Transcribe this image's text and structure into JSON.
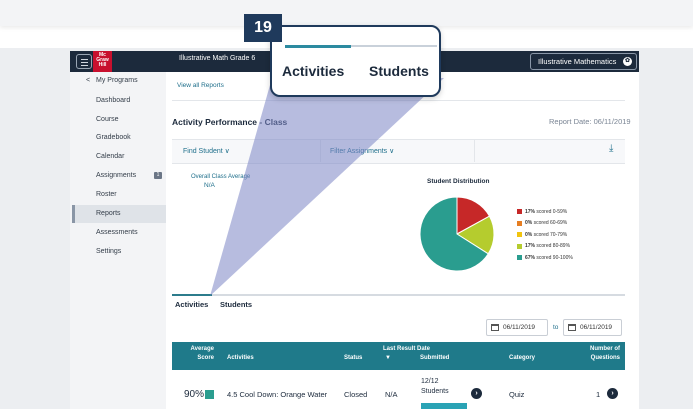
{
  "header": {
    "logo_text": "Mc Graw Hill",
    "app_title": "Illustrative Math Grade 6",
    "brand": "Illustrative Mathematics"
  },
  "sidebar": {
    "back_label": "My Programs",
    "items": [
      {
        "label": "Dashboard"
      },
      {
        "label": "Course"
      },
      {
        "label": "Gradebook"
      },
      {
        "label": "Calendar"
      },
      {
        "label": "Assignments",
        "badge": "1"
      },
      {
        "label": "Roster"
      },
      {
        "label": "Reports",
        "active": true
      },
      {
        "label": "Assessments"
      },
      {
        "label": "Settings"
      }
    ]
  },
  "main": {
    "view_all": "View all Reports",
    "title": "Activity Performance - Class",
    "report_date": "Report Date: 06/11/2019",
    "find_student": "Find Student",
    "filter_assignments": "Filter Assignments",
    "overall_label": "Overall Class Average",
    "overall_value": "N/A",
    "distribution_title": "Student Distribution",
    "tabs": [
      "Activities",
      "Students"
    ],
    "date_from": "06/11/2019",
    "date_to_label": "to",
    "date_to": "06/11/2019"
  },
  "chart_data": {
    "type": "pie",
    "title": "Student Distribution",
    "slices": [
      {
        "label": "scored 0-59%",
        "pct_text": "17%",
        "value": 17,
        "color": "#c62828"
      },
      {
        "label": "scored 60-69%",
        "pct_text": "0%",
        "value": 0,
        "color": "#e67e22"
      },
      {
        "label": "scored 70-79%",
        "pct_text": "0%",
        "value": 0,
        "color": "#f1c40f"
      },
      {
        "label": "scored 80-89%",
        "pct_text": "17%",
        "value": 17,
        "color": "#b5cc2e"
      },
      {
        "label": "scored 90-100%",
        "pct_text": "67%",
        "value": 66,
        "color": "#2a9d8f"
      }
    ]
  },
  "table": {
    "headers": {
      "avg_line1": "Average",
      "avg_line2": "Score",
      "activities": "Activities",
      "status": "Status",
      "last_line1": "Last Result Date",
      "last_line2": "▼",
      "submitted": "Submitted",
      "category": "Category",
      "num_line1": "Number of",
      "num_line2": "Questions"
    },
    "rows": [
      {
        "score": "90%",
        "activity": "4.5 Cool Down: Orange Water",
        "status": "Closed",
        "last_result": "N/A",
        "submitted_line1": "12/12",
        "submitted_line2": "Students",
        "category": "Quiz",
        "questions": "1"
      }
    ]
  },
  "callout": {
    "number": "19",
    "tab_activities": "Activities",
    "tab_students": "Students"
  },
  "colors": {
    "header_bg": "#1c2a3c",
    "table_header_bg": "#1f7a8a",
    "callout_border": "#1f3a5c",
    "tab_accent": "#2c7c8c"
  }
}
